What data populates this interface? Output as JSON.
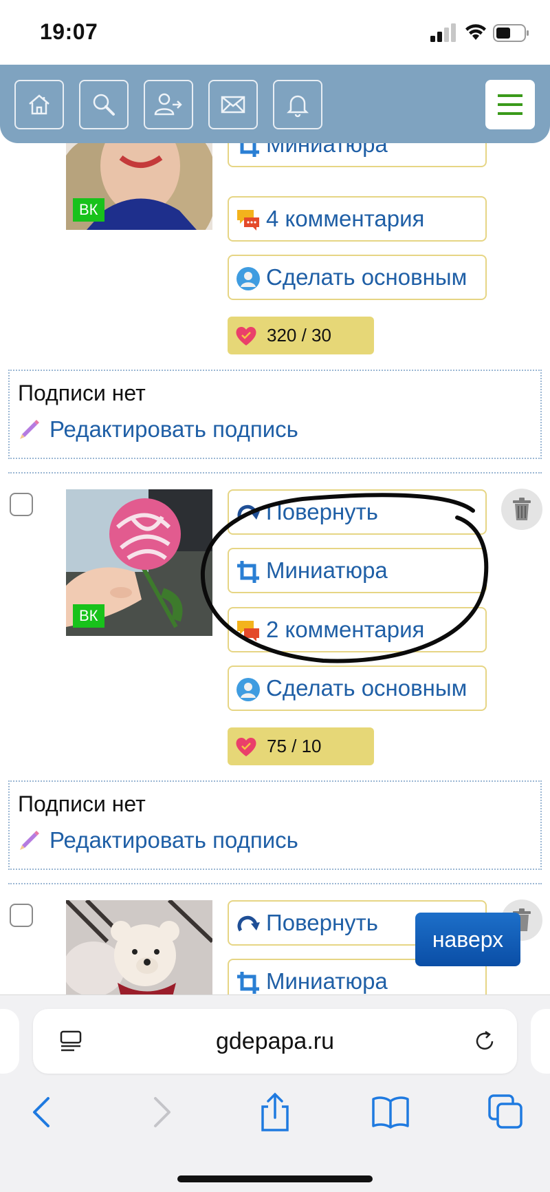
{
  "status_bar": {
    "time": "19:07"
  },
  "post_top": {
    "vk_badge": "ВК",
    "buttons": {
      "thumbnail": "Миниатюра",
      "comments": "4 комментария",
      "make_main": "Сделать основным"
    },
    "likes": "320 / 30",
    "caption": {
      "title": "Подписи нет",
      "edit": "Редактировать подпись"
    }
  },
  "post_rose": {
    "vk_badge": "ВК",
    "buttons": {
      "rotate": "Повернуть",
      "thumbnail": "Миниатюра",
      "comments": "2 комментария",
      "make_main": "Сделать основным"
    },
    "likes": "75 / 10",
    "caption": {
      "title": "Подписи нет",
      "edit": "Редактировать подпись"
    }
  },
  "post_bear": {
    "buttons": {
      "rotate": "Повернуть",
      "thumbnail": "Миниатюра"
    }
  },
  "to_top": "наверх",
  "browser": {
    "url": "gdepapa.ru"
  },
  "colors": {
    "header": "#7fa3c0",
    "accent_link": "#1f5fa6",
    "button_border": "#e6d584",
    "likes_bg": "#e6d777",
    "menu_green": "#3a9a1a"
  }
}
